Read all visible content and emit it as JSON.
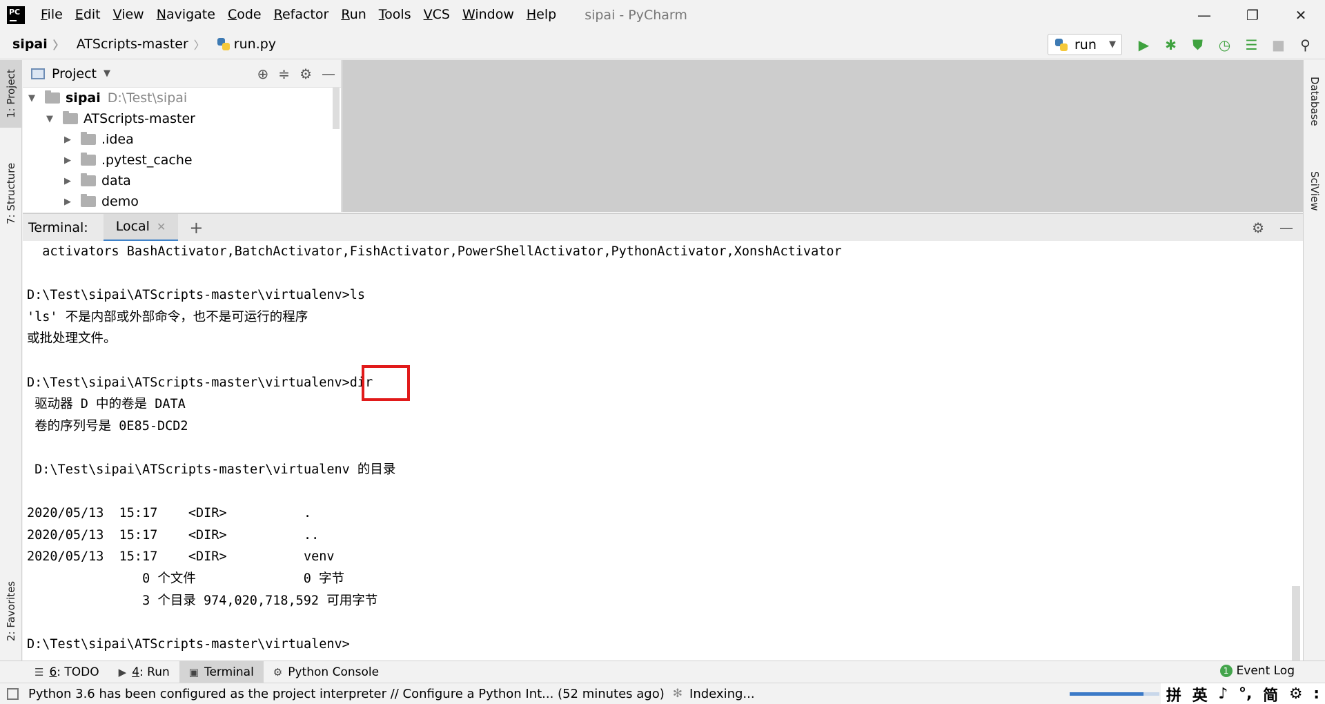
{
  "window": {
    "title": "sipai - PyCharm",
    "minimize": "—",
    "restore": "❐",
    "close": "✕"
  },
  "menu": [
    {
      "label": "File",
      "mnemonic": "F",
      "rest": "ile"
    },
    {
      "label": "Edit",
      "mnemonic": "E",
      "rest": "dit"
    },
    {
      "label": "View",
      "mnemonic": "V",
      "rest": "iew"
    },
    {
      "label": "Navigate",
      "mnemonic": "N",
      "rest": "avigate"
    },
    {
      "label": "Code",
      "mnemonic": "C",
      "rest": "ode"
    },
    {
      "label": "Refactor",
      "mnemonic": "R",
      "rest": "efactor"
    },
    {
      "label": "Run",
      "mnemonic": "R",
      "rest": "un"
    },
    {
      "label": "Tools",
      "mnemonic": "T",
      "rest": "ools"
    },
    {
      "label": "VCS",
      "mnemonic": "V",
      "rest": "CS"
    },
    {
      "label": "Window",
      "mnemonic": "W",
      "rest": "indow"
    },
    {
      "label": "Help",
      "mnemonic": "H",
      "rest": "elp"
    }
  ],
  "breadcrumb": {
    "project": "sipai",
    "folder": "ATScripts-master",
    "file": "run.py"
  },
  "run_config": {
    "label": "run"
  },
  "left_strip": {
    "project_tab": "1: Project",
    "structure_tab": "7: Structure",
    "favorites_tab": "2: Favorites"
  },
  "right_strip": {
    "database_tab": "Database",
    "sciview_tab": "SciView"
  },
  "project_panel": {
    "title": "Project",
    "tree": [
      {
        "name": "sipai",
        "path": "D:\\Test\\sipai",
        "indent": 0,
        "expanded": true,
        "bold": true
      },
      {
        "name": "ATScripts-master",
        "path": "",
        "indent": 1,
        "expanded": true,
        "bold": false
      },
      {
        "name": ".idea",
        "path": "",
        "indent": 2,
        "expanded": false,
        "bold": false
      },
      {
        "name": ".pytest_cache",
        "path": "",
        "indent": 2,
        "expanded": false,
        "bold": false
      },
      {
        "name": "data",
        "path": "",
        "indent": 2,
        "expanded": false,
        "bold": false
      },
      {
        "name": "demo",
        "path": "",
        "indent": 2,
        "expanded": false,
        "bold": false
      }
    ]
  },
  "terminal": {
    "label": "Terminal:",
    "tab": "Local",
    "lines": [
      "  activators BashActivator,BatchActivator,FishActivator,PowerShellActivator,PythonActivator,XonshActivator",
      "",
      "D:\\Test\\sipai\\ATScripts-master\\virtualenv>ls",
      "'ls' 不是内部或外部命令，也不是可运行的程序",
      "或批处理文件。",
      "",
      "D:\\Test\\sipai\\ATScripts-master\\virtualenv>dir",
      " 驱动器 D 中的卷是 DATA",
      " 卷的序列号是 0E85-DCD2",
      "",
      " D:\\Test\\sipai\\ATScripts-master\\virtualenv 的目录",
      "",
      "2020/05/13  15:17    <DIR>          .",
      "2020/05/13  15:17    <DIR>          ..",
      "2020/05/13  15:17    <DIR>          venv",
      "               0 个文件              0 字节",
      "               3 个目录 974,020,718,592 可用字节",
      "",
      "D:\\Test\\sipai\\ATScripts-master\\virtualenv>"
    ]
  },
  "bottom_tabs": [
    {
      "num": "6",
      "label": ": TODO",
      "icon": "☰",
      "active": false
    },
    {
      "num": "4",
      "label": ": Run",
      "icon": "▶",
      "active": false
    },
    {
      "num": "",
      "label": "Terminal",
      "icon": "▣",
      "active": true
    },
    {
      "num": "",
      "label": "Python Console",
      "icon": "⚙",
      "active": false
    }
  ],
  "event_log": {
    "badge": "1",
    "label": "Event Log"
  },
  "status": {
    "message": "Python 3.6 has been configured as the project interpreter // Configure a Python Int... (52 minutes ago)",
    "indexing": "Indexing...",
    "progress": 0.82
  },
  "ime": [
    "拼",
    "英",
    "♪",
    "°,",
    "简",
    "⚙",
    ":"
  ],
  "colors": {
    "accent": "#4083c9",
    "highlight": "#e11a1a",
    "run_green": "#3fa23f"
  }
}
